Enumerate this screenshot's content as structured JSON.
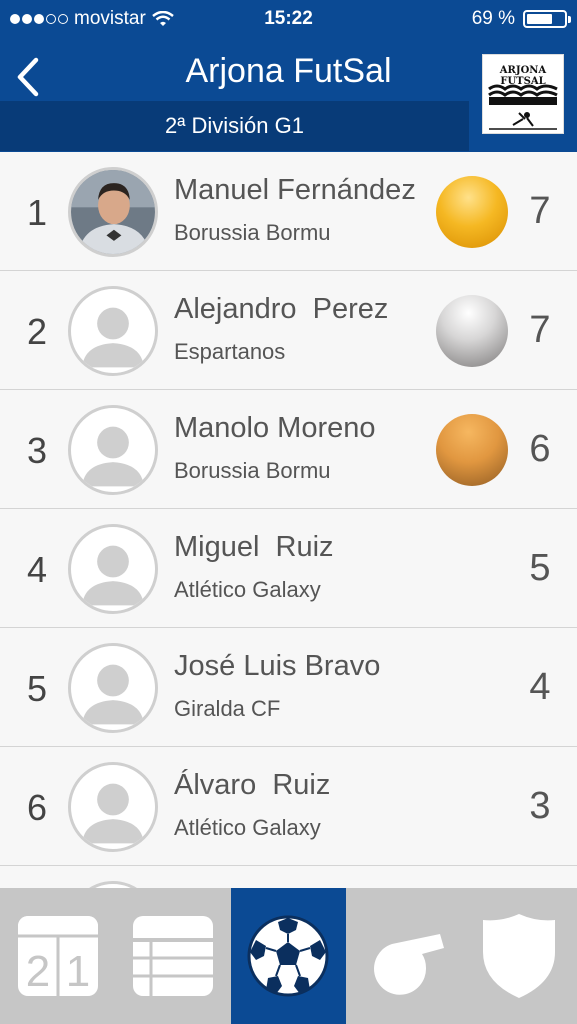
{
  "status": {
    "carrier": "movistar",
    "time": "15:22",
    "battery_text": "69 %",
    "battery_level": 0.69
  },
  "header": {
    "title": "Arjona FutSal",
    "subtitle": "2ª División G1",
    "logo_text": "ARJONA FUTSAL"
  },
  "players": [
    {
      "rank": "1",
      "name": "Manuel Fernández",
      "team": "Borussia Bormu",
      "goals": "7",
      "medal": "gold",
      "photo": true
    },
    {
      "rank": "2",
      "name": "Alejandro  Perez",
      "team": "Espartanos",
      "goals": "7",
      "medal": "silver",
      "photo": false
    },
    {
      "rank": "3",
      "name": "Manolo Moreno",
      "team": "Borussia Bormu",
      "goals": "6",
      "medal": "bronze",
      "photo": false
    },
    {
      "rank": "4",
      "name": "Miguel  Ruiz",
      "team": "Atlético Galaxy",
      "goals": "5",
      "medal": null,
      "photo": false
    },
    {
      "rank": "5",
      "name": "José Luis Bravo",
      "team": "Giralda CF",
      "goals": "4",
      "medal": null,
      "photo": false
    },
    {
      "rank": "6",
      "name": "Álvaro  Ruiz",
      "team": "Atlético Galaxy",
      "goals": "3",
      "medal": null,
      "photo": false
    }
  ],
  "tabs": [
    {
      "icon": "scoreboard-icon",
      "active": false
    },
    {
      "icon": "table-icon",
      "active": false
    },
    {
      "icon": "soccer-ball-icon",
      "active": true
    },
    {
      "icon": "whistle-icon",
      "active": false
    },
    {
      "icon": "shield-icon",
      "active": false
    }
  ],
  "colors": {
    "header_bg": "#0b4a94",
    "subtitle_bg": "#083b78",
    "tabbar_bg": "#c6c6c6"
  }
}
